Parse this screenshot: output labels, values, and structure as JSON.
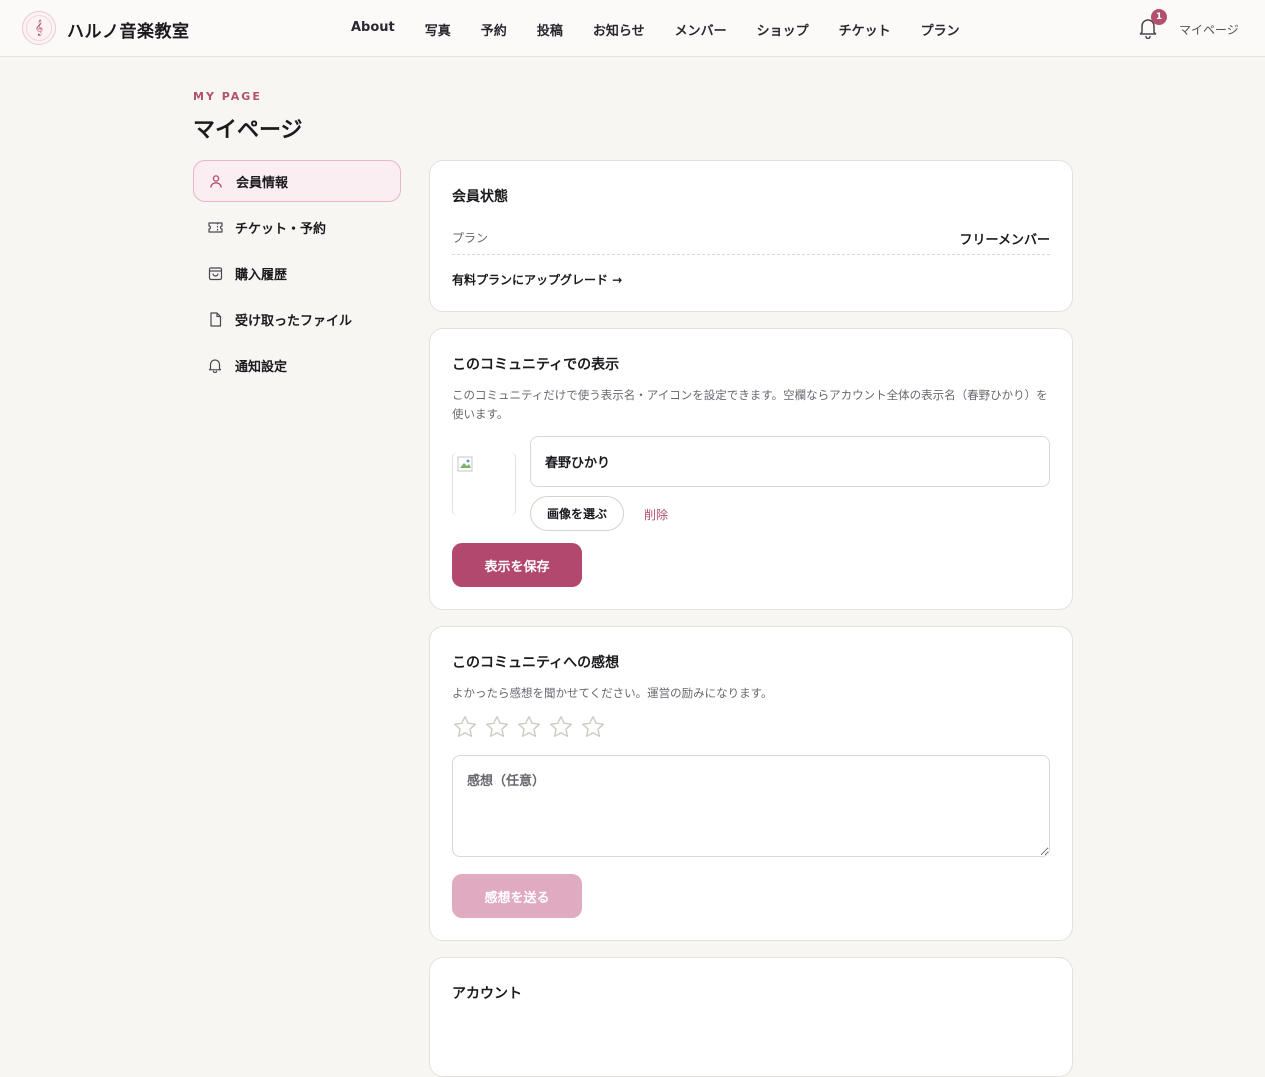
{
  "header": {
    "logo_glyph": "𝄞",
    "site_title": "ハルノ音楽教室",
    "nav": [
      "About",
      "写真",
      "予約",
      "投稿",
      "お知らせ",
      "メンバー",
      "ショップ",
      "チケット",
      "プラン"
    ],
    "notification_count": "1",
    "mypage_link": "マイページ"
  },
  "page": {
    "eyebrow": "MY PAGE",
    "title": "マイページ"
  },
  "sidebar": {
    "items": [
      {
        "label": "会員情報",
        "icon": "user-icon",
        "active": true
      },
      {
        "label": "チケット・予約",
        "icon": "ticket-icon",
        "active": false
      },
      {
        "label": "購入履歴",
        "icon": "shopping-bag-icon",
        "active": false
      },
      {
        "label": "受け取ったファイル",
        "icon": "file-icon",
        "active": false
      },
      {
        "label": "通知設定",
        "icon": "bell-icon",
        "active": false
      }
    ]
  },
  "membership": {
    "title": "会員状態",
    "plan_label": "プラン",
    "plan_value": "フリーメンバー",
    "upgrade_link": "有料プランにアップグレード →"
  },
  "display": {
    "title": "このコミュニティでの表示",
    "description": "このコミュニティだけで使う表示名・アイコンを設定できます。空欄ならアカウント全体の表示名（春野ひかり）を使います。",
    "name_value": "春野ひかり",
    "choose_image": "画像を選ぶ",
    "delete": "削除",
    "save": "表示を保存"
  },
  "feedback": {
    "title": "このコミュニティへの感想",
    "description": "よかったら感想を聞かせてください。運営の励みになります。",
    "rating": 0,
    "rating_max": 5,
    "placeholder": "感想（任意）",
    "send": "感想を送る"
  },
  "account": {
    "title": "アカウント"
  },
  "colors": {
    "accent": "#b3486e",
    "accent_disabled": "#e0aac0",
    "background": "#f8f6f3"
  }
}
